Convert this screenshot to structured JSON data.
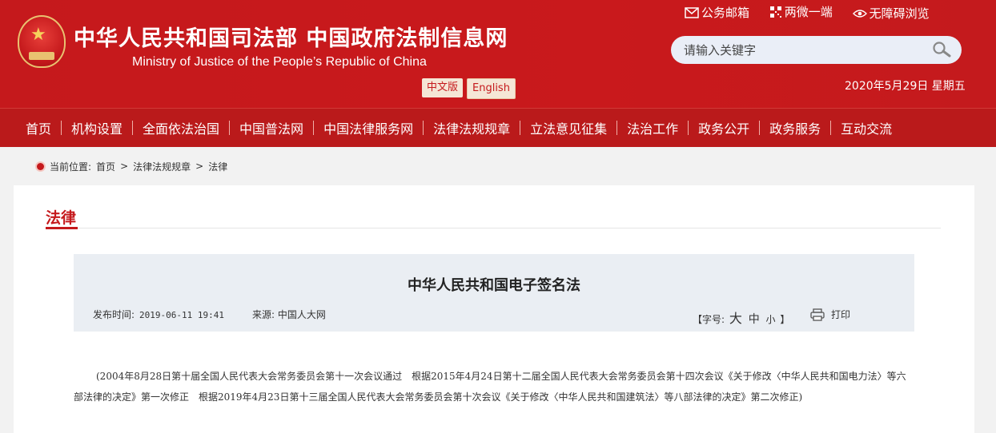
{
  "header": {
    "title": "中华人民共和国司法部  中国政府法制信息网",
    "subtitle": "Ministry of Justice of the People’s Republic of China",
    "lang_zh": "中文版",
    "lang_en": "English",
    "top_links": [
      "公务邮箱",
      "两微一端",
      "无障碍浏览"
    ],
    "search_placeholder": "请输入关键字",
    "date": "2020年5月29日 星期五"
  },
  "nav": [
    "首页",
    "机构设置",
    "全面依法治国",
    "中国普法网",
    "中国法律服务网",
    "法律法规规章",
    "立法意见征集",
    "法治工作",
    "政务公开",
    "政务服务",
    "互动交流"
  ],
  "breadcrumb": {
    "label": "当前位置:",
    "items": [
      "首页",
      ">",
      "法律法规规章",
      ">",
      "法律"
    ]
  },
  "category": "法律",
  "article": {
    "title": "中华人民共和国电子签名法",
    "publish_label": "发布时间:",
    "publish_time": "2019-06-11 19:41",
    "source_label": "来源:",
    "source": "中国人大网",
    "font_label": "【字号:",
    "font_big": "大",
    "font_mid": "中",
    "font_small": "小",
    "font_close": "】",
    "print": "打印",
    "intro": "(2004年8月28日第十届全国人民代表大会常务委员会第十一次会议通过　根据2015年4月24日第十二届全国人民代表大会常务委员会第十四次会议《关于修改〈中华人民共和国电力法〉等六部法律的决定》第一次修正　根据2019年4月23日第十三届全国人民代表大会常务委员会第十次会议《关于修改〈中华人民共和国建筑法〉等八部法律的决定》第二次修正)"
  },
  "colors": {
    "brand_red": "#c5191c",
    "nav_red": "#ba1a1b",
    "title_box": "#eaeef3"
  }
}
